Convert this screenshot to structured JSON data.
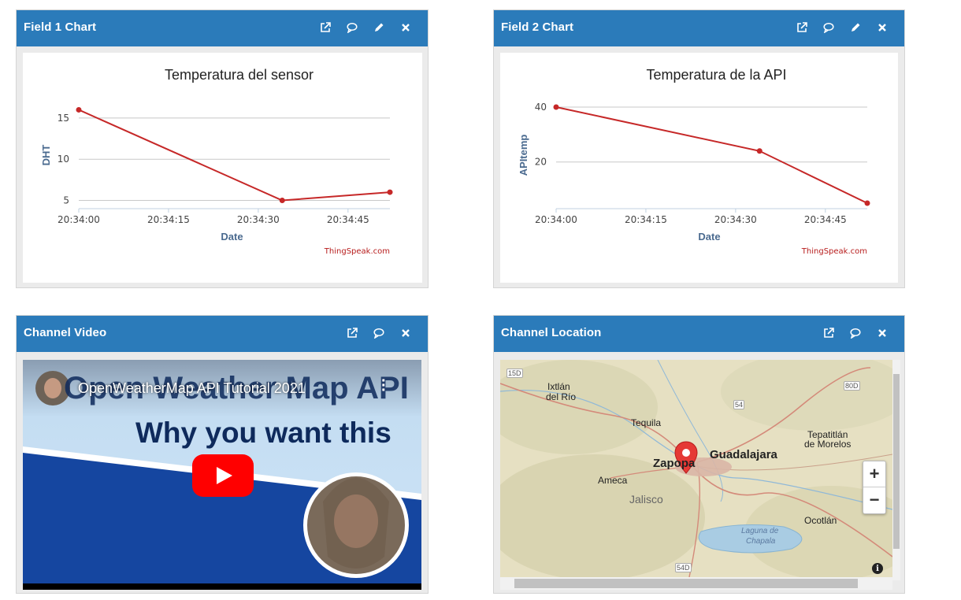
{
  "panels": {
    "field1": {
      "title": "Field 1 Chart",
      "icons": [
        "external-link-icon",
        "comment-icon",
        "pencil-icon",
        "close-icon"
      ]
    },
    "field2": {
      "title": "Field 2 Chart",
      "icons": [
        "external-link-icon",
        "comment-icon",
        "pencil-icon",
        "close-icon"
      ]
    },
    "video": {
      "title": "Channel Video",
      "icons": [
        "external-link-icon",
        "comment-icon",
        "close-icon"
      ],
      "video_title": "OpenWeatherMap API Tutorial 2021",
      "thumb_heading": "Open Weather Map API",
      "thumb_subheading": "Why you want this"
    },
    "location": {
      "title": "Channel Location",
      "icons": [
        "external-link-icon",
        "comment-icon",
        "close-icon"
      ],
      "zoom_in": "+",
      "zoom_out": "−",
      "info": "i",
      "labels": {
        "guadalajara": "Guadalajara",
        "zapopan": "Zapopa",
        "tequila": "Tequila",
        "ixtlan_1": "Ixtlán",
        "ixtlan_2": "del Río",
        "ameca": "Ameca",
        "jalisco": "Jalisco",
        "tepatitlan_1": "Tepatitlán",
        "tepatitlan_2": "de Morelos",
        "ocotlan": "Ocotlán",
        "laguna_1": "Laguna de",
        "laguna_2": "Chapala",
        "r15d": "15D",
        "r80d": "80D",
        "r54": "54",
        "r54d": "54D"
      }
    }
  },
  "chart_data": [
    {
      "type": "line",
      "title": "Temperatura del sensor",
      "xlabel": "Date",
      "ylabel": "DHT",
      "x": [
        "20:34:00",
        "20:34:34",
        "20:34:52"
      ],
      "series": [
        {
          "values": [
            16,
            5,
            6
          ],
          "color": "#c62828"
        }
      ],
      "xticks": [
        "20:34:00",
        "20:34:15",
        "20:34:30",
        "20:34:45"
      ],
      "yticks": [
        5,
        10,
        15
      ],
      "xlim": [
        "20:34:00",
        "20:34:52"
      ],
      "ylim": [
        4,
        17
      ],
      "grid": true,
      "credit": "ThingSpeak.com"
    },
    {
      "type": "line",
      "title": "Temperatura de la API",
      "xlabel": "Date",
      "ylabel": "APItemp",
      "x": [
        "20:34:00",
        "20:34:34",
        "20:34:52"
      ],
      "series": [
        {
          "values": [
            40,
            24,
            5
          ],
          "color": "#c62828"
        }
      ],
      "xticks": [
        "20:34:00",
        "20:34:15",
        "20:34:30",
        "20:34:45"
      ],
      "yticks": [
        20,
        40
      ],
      "xlim": [
        "20:34:00",
        "20:34:52"
      ],
      "ylim": [
        3,
        42
      ],
      "grid": true,
      "credit": "ThingSpeak.com"
    }
  ]
}
